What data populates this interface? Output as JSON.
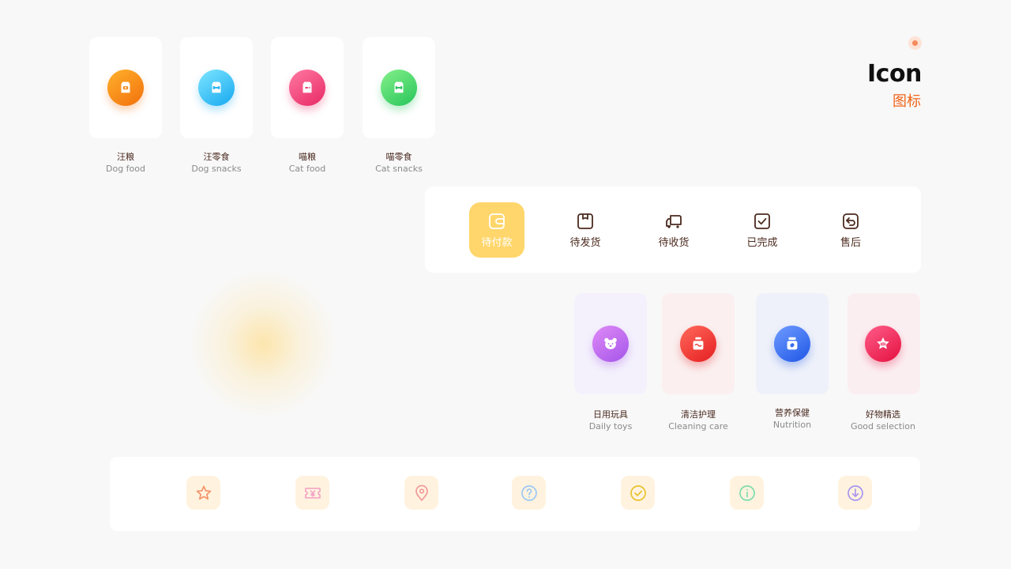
{
  "header": {
    "title_en": "Icon",
    "title_zh": "图标"
  },
  "pet_cards": [
    {
      "zh": "汪粮",
      "en": "Dog food",
      "icon": "dog-food-bag-icon",
      "colors": [
        "#ffb12b",
        "#f2700c"
      ]
    },
    {
      "zh": "汪零食",
      "en": "Dog snacks",
      "icon": "dog-snack-bag-icon",
      "colors": [
        "#7ee6ff",
        "#16a8f0"
      ]
    },
    {
      "zh": "喵粮",
      "en": "Cat food",
      "icon": "cat-food-bag-icon",
      "colors": [
        "#ff7aa3",
        "#e82865"
      ]
    },
    {
      "zh": "喵零食",
      "en": "Cat snacks",
      "icon": "cat-snack-bag-icon",
      "colors": [
        "#86f08a",
        "#25c55a"
      ]
    }
  ],
  "order_status": [
    {
      "label": "待付款",
      "icon": "wallet-icon",
      "active": true
    },
    {
      "label": "待发货",
      "icon": "package-icon",
      "active": false
    },
    {
      "label": "待收货",
      "icon": "truck-icon",
      "active": false
    },
    {
      "label": "已完成",
      "icon": "check-square-icon",
      "active": false
    },
    {
      "label": "售后",
      "icon": "return-icon",
      "active": false
    }
  ],
  "categories": [
    {
      "zh": "日用玩具",
      "en": "Daily toys",
      "icon": "bear-face-icon",
      "bg": "#f4f1fc",
      "colors": [
        "#e08af6",
        "#a455ea"
      ]
    },
    {
      "zh": "清洁护理",
      "en": "Cleaning care",
      "icon": "cleaning-bottle-icon",
      "bg": "#fbefef",
      "colors": [
        "#ff6a5c",
        "#e51e20"
      ]
    },
    {
      "zh": "营养保健",
      "en": "Nutrition",
      "icon": "supplement-jar-icon",
      "bg": "#eef1fa",
      "colors": [
        "#6f9cff",
        "#1f56e6"
      ]
    },
    {
      "zh": "好物精选",
      "en": "Good selection",
      "icon": "star-badge-icon",
      "bg": "#fbeef1",
      "colors": [
        "#ff5d8a",
        "#e4103f"
      ]
    }
  ],
  "tools": [
    {
      "icon": "star-icon",
      "color": "#f5946a",
      "bg": "#fff3df"
    },
    {
      "icon": "coupon-icon",
      "color": "#f4a0c4",
      "bg": "#fff3df"
    },
    {
      "icon": "location-pin-icon",
      "color": "#f39b9b",
      "bg": "#fff3df"
    },
    {
      "icon": "help-icon",
      "color": "#9dc8f3",
      "bg": "#fff3df"
    },
    {
      "icon": "check-circle-icon",
      "color": "#e8c22e",
      "bg": "#fff3df"
    },
    {
      "icon": "info-icon",
      "color": "#7edcae",
      "bg": "#fff3df"
    },
    {
      "icon": "download-icon",
      "color": "#a895f0",
      "bg": "#fff3df"
    }
  ],
  "colors": {
    "accent": "#f06418",
    "order_active": "#ffd66b",
    "brown_text": "#4b2a1e"
  }
}
